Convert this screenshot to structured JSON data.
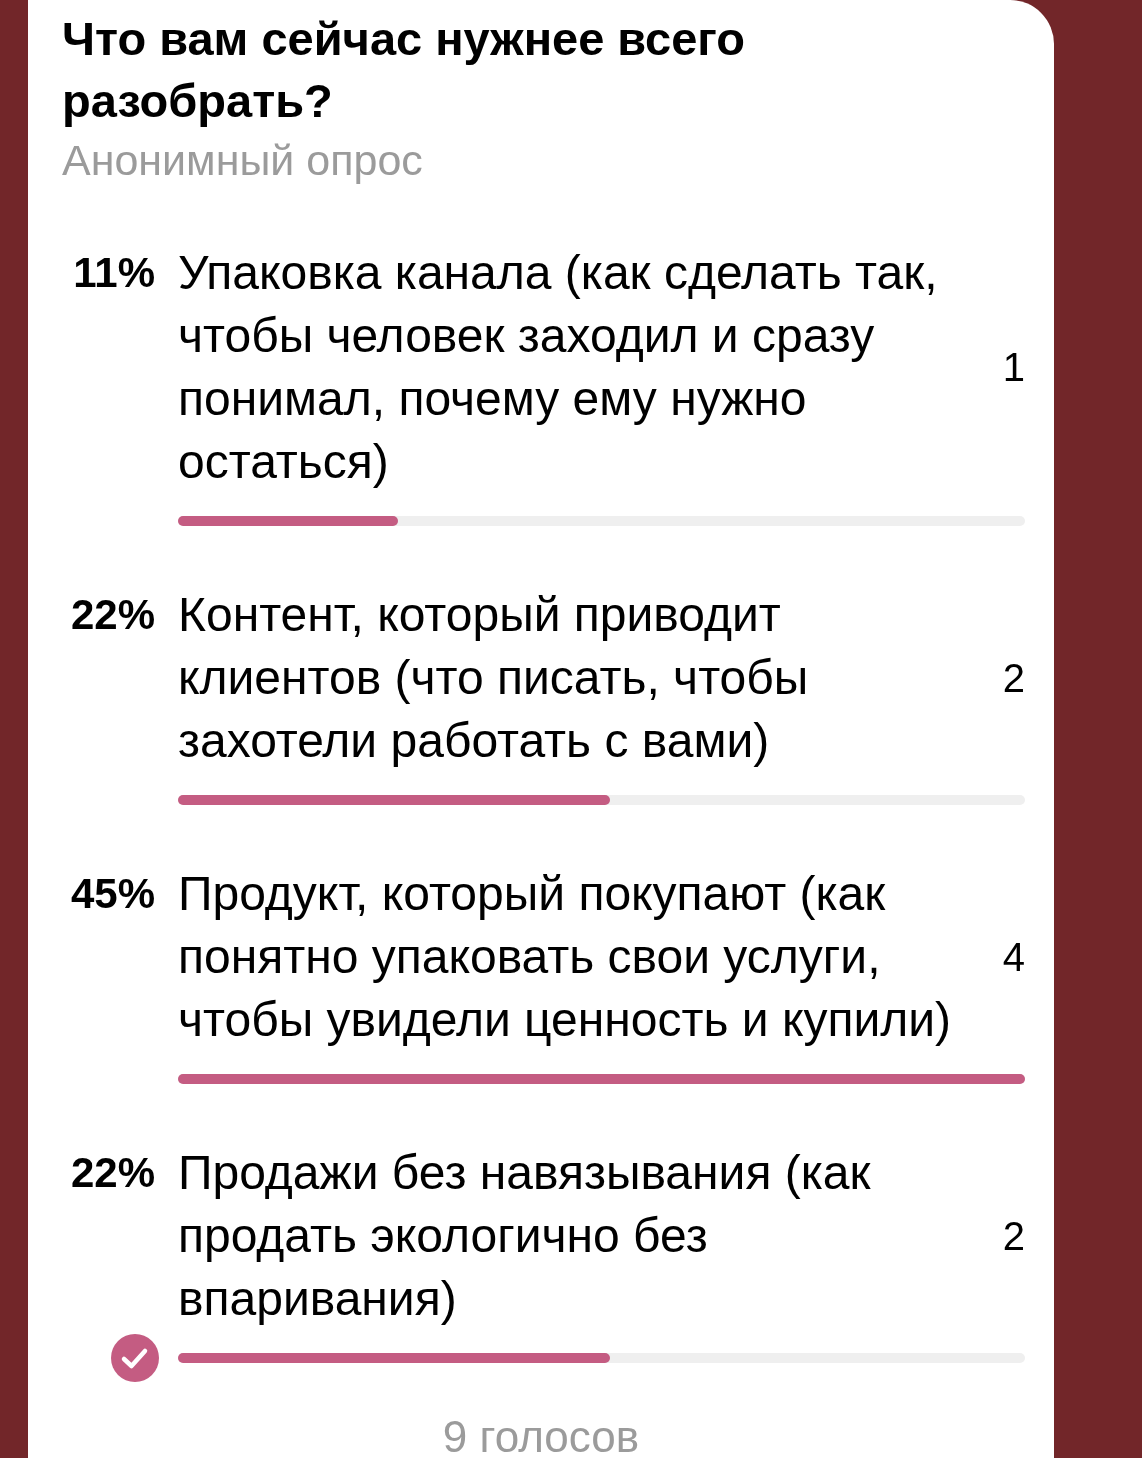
{
  "poll": {
    "question": "Что вам сейчас нужнее всего разобрать?",
    "subtitle": "Анонимный опрос",
    "options": [
      {
        "percent": "11%",
        "text": "Упаковка канала (как сделать так, чтобы человек заходил и сразу понимал, почему ему нужно остаться)",
        "count": "1",
        "level": 0.26,
        "selected": false
      },
      {
        "percent": "22%",
        "text": "Контент, который приводит клиентов (что писать, чтобы захотели работать с вами)",
        "count": "2",
        "level": 0.51,
        "selected": false
      },
      {
        "percent": "45%",
        "text": "Продукт, который покупают (как понятно упаковать свои услуги, чтобы увидели ценность и купили)",
        "count": "4",
        "level": 1,
        "selected": false
      },
      {
        "percent": "22%",
        "text": "Продажи без навязывания (как продать экологично без впаривания)",
        "count": "2",
        "level": 0.51,
        "selected": true
      }
    ],
    "total": "9 голосов"
  }
}
